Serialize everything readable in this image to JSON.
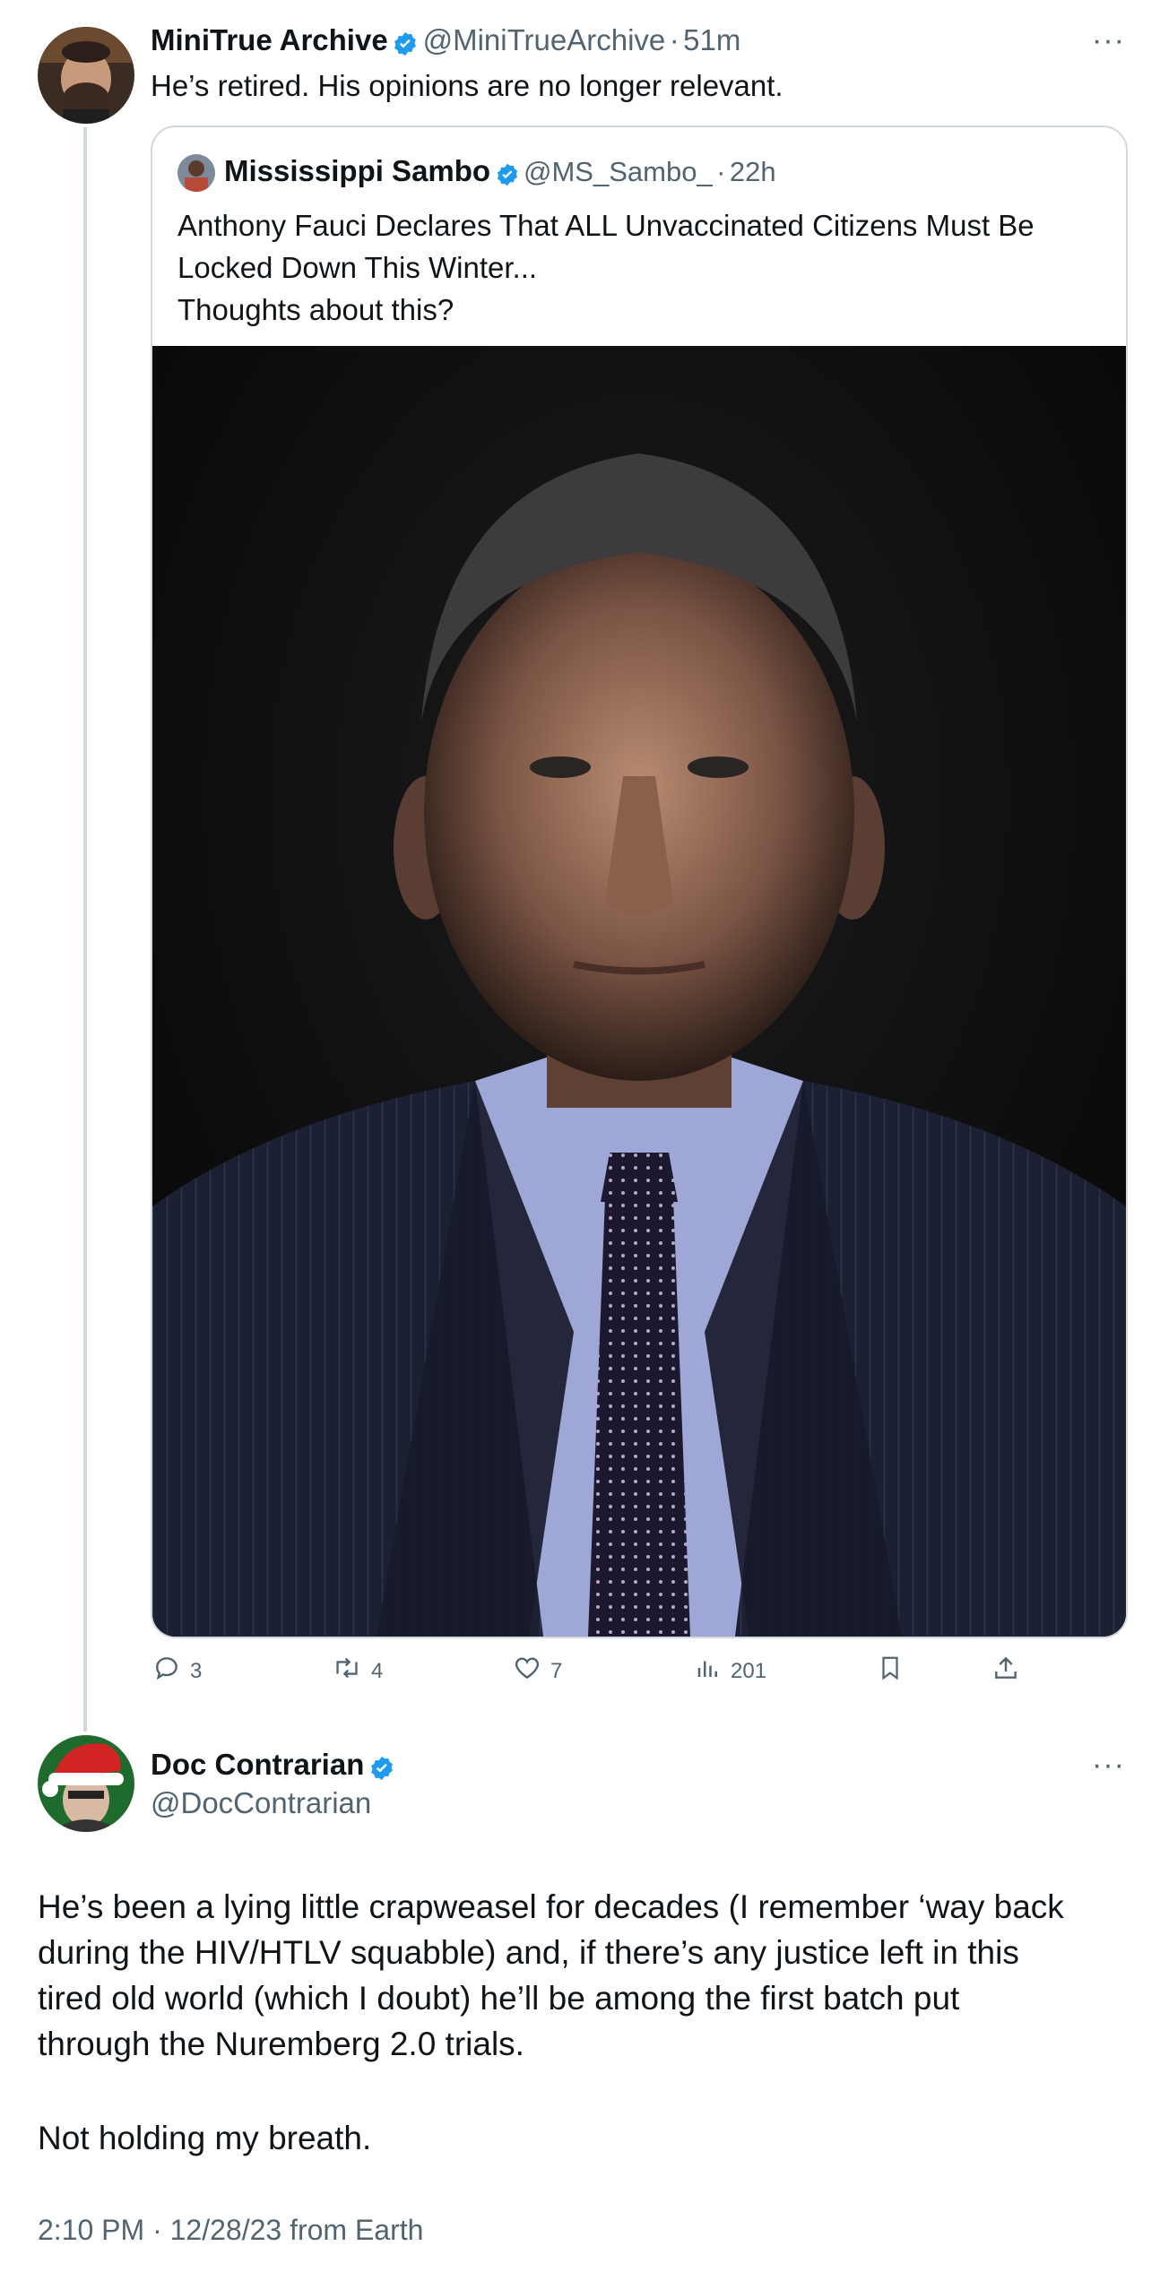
{
  "tweet1": {
    "display_name": "MiniTrue Archive",
    "handle": "@MiniTrueArchive",
    "separator": "·",
    "time": "51m",
    "text": "He’s retired. His opinions are no longer relevant.",
    "more_label": "···",
    "avatar": "avatar-bearded-man"
  },
  "quoted": {
    "display_name": "Mississippi Sambo",
    "handle": "@MS_Sambo_",
    "separator": "·",
    "time": "22h",
    "text_line1": "Anthony Fauci Declares That ALL Unvaccinated Citizens Must Be",
    "text_line2": "Locked Down This Winter...",
    "text_line3": "Thoughts about this?",
    "image": "portrait-man-in-suit-dark-background"
  },
  "actions": {
    "replies": "3",
    "retweets": "4",
    "likes": "7",
    "views": "201"
  },
  "tweet2": {
    "display_name": "Doc Contrarian",
    "handle": "@DocContrarian",
    "more_label": "···",
    "avatar": "avatar-santa-hat",
    "para1_line1": "He’s been a lying little crapweasel for decades (I remember ‘way back",
    "para1_line2": "during the HIV/HTLV squabble) and, if there’s any justice left in this",
    "para1_line3": "tired old world (which I doubt) he’ll be among the first batch put",
    "para1_line4": "through the Nuremberg 2.0 trials.",
    "para2": "Not holding my breath.",
    "timestamp": "2:10 PM · 12/28/23 from Earth"
  },
  "colors": {
    "verified": "#1d9bf0",
    "muted_text": "#536471",
    "border": "#cfd9de"
  }
}
